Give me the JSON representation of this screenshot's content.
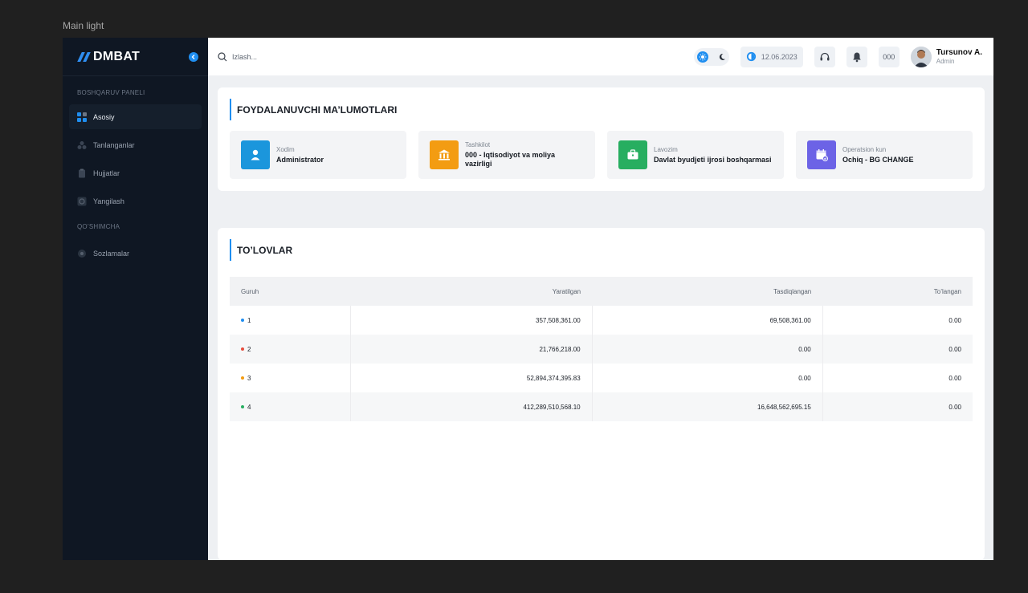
{
  "canvas_label": "Main light",
  "brand": {
    "name": "DMBAT",
    "accent": "#2f8ef0"
  },
  "sidebar": {
    "sections": [
      {
        "title": "BOSHQARUV PANELI",
        "items": [
          {
            "label": "Asosiy",
            "icon": "grid-icon",
            "active": true
          },
          {
            "label": "Tanlanganlar",
            "icon": "favorites-icon",
            "active": false
          },
          {
            "label": "Hujjatlar",
            "icon": "clipboard-icon",
            "active": false
          },
          {
            "label": "Yangilash",
            "icon": "refresh-icon",
            "active": false
          }
        ]
      },
      {
        "title": "QO’SHIMCHA",
        "items": [
          {
            "label": "Sozlamalar",
            "icon": "gear-icon",
            "active": false
          }
        ]
      }
    ]
  },
  "topbar": {
    "search_placeholder": "Izlash...",
    "date": "12.06.2023",
    "code": "000",
    "user": {
      "name": "Tursunov A.",
      "role": "Admin"
    }
  },
  "user_info": {
    "title": "FOYDALANUVCHI MA’LUMOTLARI",
    "items": [
      {
        "label": "Xodim",
        "value": "Administrator",
        "color": "#1b96dc",
        "icon": "user-icon"
      },
      {
        "label": "Tashkilot",
        "value": "000 - Iqtisodiyot va moliya vazirligi",
        "color": "#f39c12",
        "icon": "bank-icon"
      },
      {
        "label": "Lavozim",
        "value": "Davlat byudjeti ijrosi boshqarmasi",
        "color": "#27ae60",
        "icon": "briefcase-icon"
      },
      {
        "label": "Operatsion kun",
        "value": "Ochiq - BG CHANGE",
        "color": "#6c63e6",
        "icon": "calendar-check-icon"
      }
    ]
  },
  "payments": {
    "title": "TO’LOVLAR",
    "columns": [
      "Guruh",
      "Yaratilgan",
      "Tasdiqlangan",
      "To’langan"
    ],
    "rows": [
      {
        "group": "1",
        "dot": "#1f8ef0",
        "created": "357,508,361.00",
        "approved": "69,508,361.00",
        "paid": "0.00"
      },
      {
        "group": "2",
        "dot": "#e74c3c",
        "created": "21,766,218.00",
        "approved": "0.00",
        "paid": "0.00"
      },
      {
        "group": "3",
        "dot": "#f39c12",
        "created": "52,894,374,395.83",
        "approved": "0.00",
        "paid": "0.00"
      },
      {
        "group": "4",
        "dot": "#27ae60",
        "created": "412,289,510,568.10",
        "approved": "16,648,562,695.15",
        "paid": "0.00"
      }
    ]
  }
}
